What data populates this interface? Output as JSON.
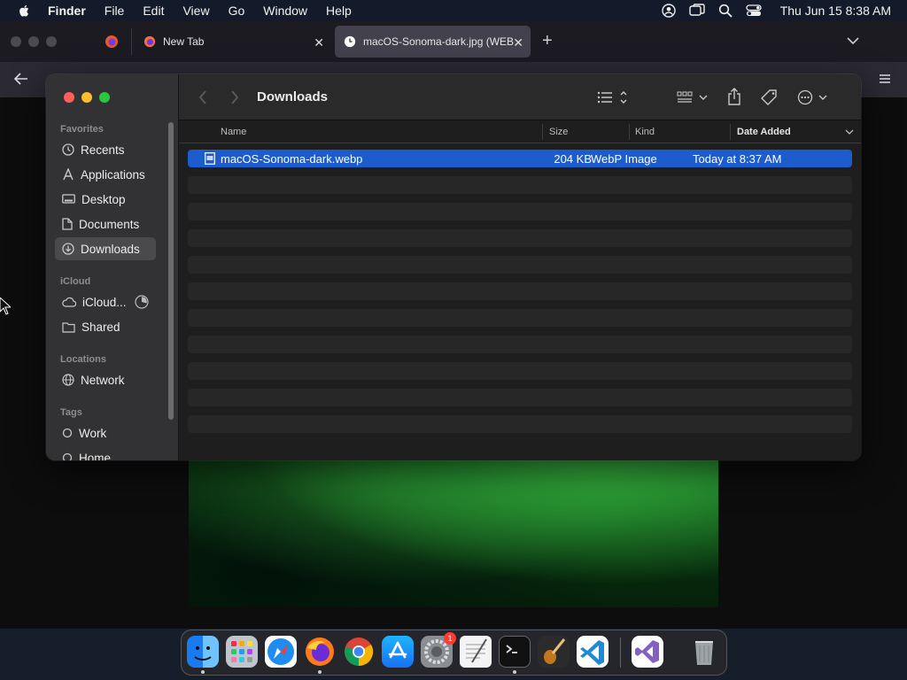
{
  "menubar": {
    "items": [
      "Finder",
      "File",
      "Edit",
      "View",
      "Go",
      "Window",
      "Help"
    ],
    "clock": "Thu Jun 15  8:38 AM"
  },
  "browser": {
    "tabs": [
      {
        "label": "New Tab"
      },
      {
        "label": "macOS-Sonoma-dark.jpg (WEB"
      }
    ]
  },
  "finder": {
    "title": "Downloads",
    "sidebar": {
      "sections": [
        {
          "heading": "Favorites",
          "items": [
            "Recents",
            "Applications",
            "Desktop",
            "Documents",
            "Downloads"
          ]
        },
        {
          "heading": "iCloud",
          "items": [
            "iCloud...",
            "Shared"
          ]
        },
        {
          "heading": "Locations",
          "items": [
            "Network"
          ]
        },
        {
          "heading": "Tags",
          "items": [
            "Work",
            "Home"
          ]
        }
      ],
      "selected": "Downloads"
    },
    "columns": {
      "name": "Name",
      "size": "Size",
      "kind": "Kind",
      "date_added": "Date Added"
    },
    "sort_column": "Date Added",
    "files": [
      {
        "name": "macOS-Sonoma-dark.webp",
        "size": "204 KB",
        "kind": "WebP Image",
        "date_added": "Today at 8:37 AM",
        "selected": true
      }
    ]
  },
  "dock": {
    "apps": [
      "Finder",
      "Launchpad",
      "Safari",
      "Firefox",
      "Chrome",
      "App Store",
      "System Settings",
      "TextEdit",
      "Terminal",
      "GarageBand",
      "Visual Studio Code",
      "Visual Studio",
      "Trash"
    ],
    "running": [
      "Finder",
      "Firefox",
      "Terminal"
    ],
    "badges": {
      "System Settings": "1"
    }
  },
  "colors": {
    "accent": "#1d5ccc",
    "menubar": "#131a29",
    "wallpaper_green": "#2a9a34"
  }
}
